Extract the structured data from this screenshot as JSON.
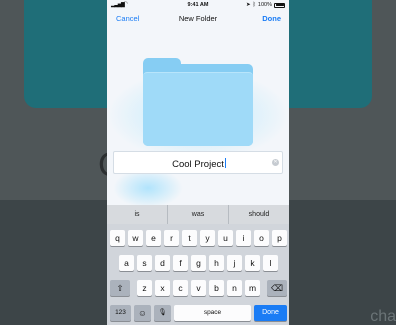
{
  "background": {
    "letter": "C",
    "bottom_text": "cha"
  },
  "status_bar": {
    "time": "9:41 AM",
    "battery": "100%",
    "signal_icon": "signal-bars",
    "wifi_icon": "wifi",
    "location_icon": "location-arrow",
    "bluetooth_icon": "bluetooth"
  },
  "navbar": {
    "cancel": "Cancel",
    "title": "New Folder",
    "done": "Done"
  },
  "folder_name": {
    "value": "Cool Project"
  },
  "keyboard": {
    "suggestions": [
      "is",
      "was",
      "should"
    ],
    "row1": [
      "q",
      "w",
      "e",
      "r",
      "t",
      "y",
      "u",
      "i",
      "o",
      "p"
    ],
    "row2": [
      "a",
      "s",
      "d",
      "f",
      "g",
      "h",
      "j",
      "k",
      "l"
    ],
    "row3": [
      "z",
      "x",
      "c",
      "v",
      "b",
      "n",
      "m"
    ],
    "shift_icon": "shift",
    "delete_icon": "backspace",
    "numbers": "123",
    "emoji_icon": "emoji",
    "mic_icon": "microphone",
    "space": "space",
    "done": "Done"
  },
  "colors": {
    "accent": "#1a7cf5",
    "folder": "#9fdaf8"
  }
}
